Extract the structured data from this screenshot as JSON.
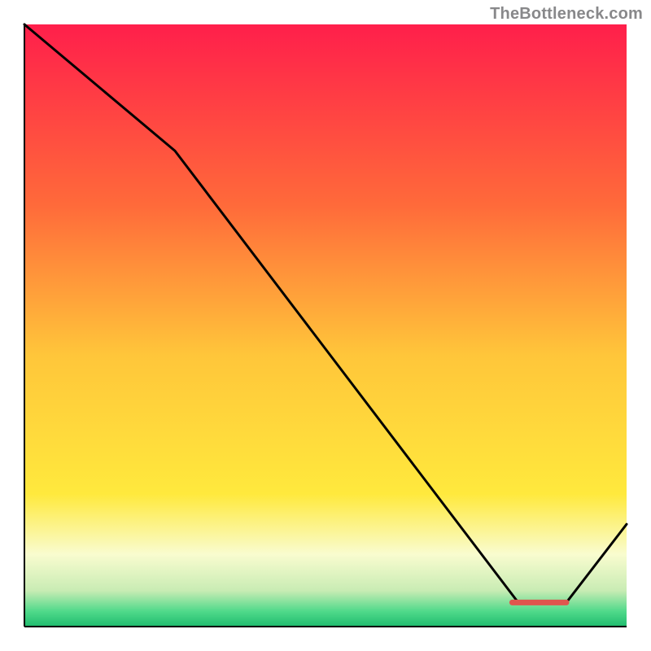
{
  "attribution": "TheBottleneck.com",
  "chart_data": {
    "type": "line",
    "title": "",
    "xlabel": "",
    "ylabel": "",
    "xlim": [
      0,
      100
    ],
    "ylim": [
      0,
      100
    ],
    "grid": false,
    "series": [
      {
        "name": "curve",
        "x": [
          0,
          25,
          82,
          90,
          100
        ],
        "values": [
          100,
          79,
          4,
          4,
          17
        ]
      }
    ],
    "gradient_stops": [
      {
        "offset": 0.0,
        "color": "#ff1f4b"
      },
      {
        "offset": 0.3,
        "color": "#ff6a3a"
      },
      {
        "offset": 0.55,
        "color": "#ffc63a"
      },
      {
        "offset": 0.78,
        "color": "#ffe93d"
      },
      {
        "offset": 0.88,
        "color": "#f9fccf"
      },
      {
        "offset": 0.94,
        "color": "#c9ecb4"
      },
      {
        "offset": 0.975,
        "color": "#4fd98a"
      },
      {
        "offset": 1.0,
        "color": "#1fbc6e"
      }
    ],
    "baseline_marker": {
      "x_start": 81,
      "x_end": 90,
      "y": 4,
      "color": "#e0554e"
    }
  }
}
